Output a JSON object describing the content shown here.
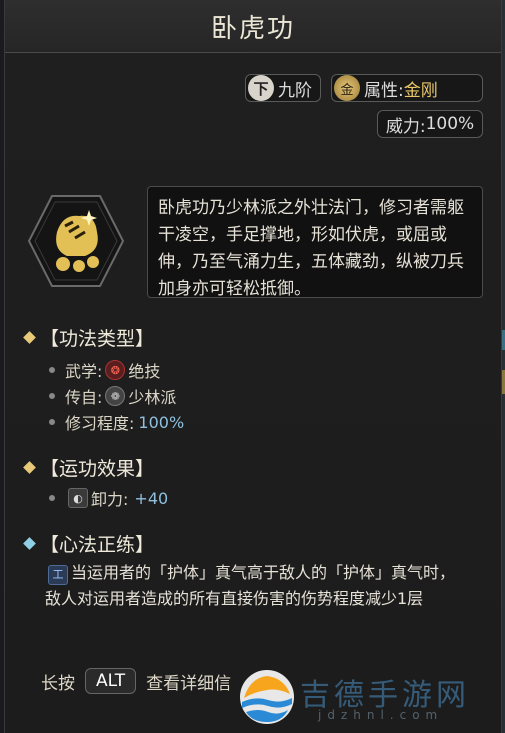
{
  "title": "卧虎功",
  "rank": {
    "icon_char": "下",
    "label": "九阶"
  },
  "attribute": {
    "icon_char": "金",
    "prefix": "属性:",
    "value": "金刚"
  },
  "power": {
    "prefix": "威力:",
    "value": "100%"
  },
  "description": "卧虎功乃少林派之外壮法门，修习者需躯干凌空，手足撑地，形如伏虎，或屈或伸，乃至气涌力生，五体藏劲，纵被刀兵加身亦可轻松抵御。",
  "sections": {
    "type": {
      "title": "【功法类型】",
      "items": [
        {
          "label": "武学:",
          "icon": "martial-skill-icon",
          "icon_char": "❂",
          "value": "绝技"
        },
        {
          "label": "传自:",
          "icon": "shaolin-icon",
          "icon_char": "❁",
          "value": "少林派"
        },
        {
          "label": "修习程度:",
          "value": "100%"
        }
      ]
    },
    "effect": {
      "title": "【运功效果】",
      "items": [
        {
          "label": "卸力:",
          "icon": "deflect-icon",
          "icon_char": "◐",
          "value": "+40"
        }
      ]
    },
    "mind": {
      "title": "【心法正练】",
      "icon": "practice-icon",
      "icon_char": "工",
      "text": "当运用者的「护体」真气高于敌人的「护体」真气时，敌人对运用者造成的所有直接伤害的伤势程度减少1层"
    }
  },
  "footer": {
    "prefix": "长按",
    "key": "ALT",
    "suffix": "查看详细信"
  },
  "watermark": {
    "text": "吉德手游网",
    "url": "jdzhnl.com"
  },
  "colors": {
    "gold": "#e8c66a",
    "accent_blue": "#8fc0e0",
    "panel": "#1c1c1c"
  }
}
